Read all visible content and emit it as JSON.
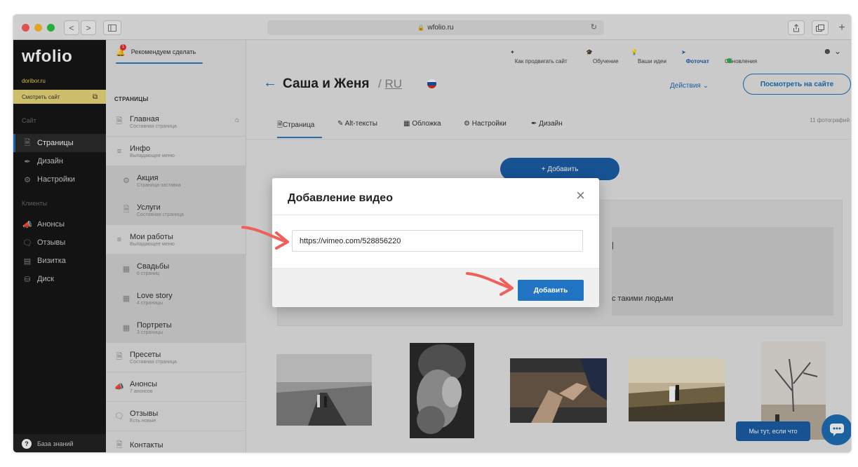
{
  "browser": {
    "url": "wfolio.ru",
    "lock_icon": "lock-icon",
    "buttons": [
      "<",
      ">"
    ]
  },
  "sidebar": {
    "logo": "wfolio",
    "domain": "doribor.ru",
    "view_site_label": "Смотреть сайт",
    "section_site": "Сайт",
    "section_clients": "Клиенты",
    "items": [
      {
        "label": "Страницы",
        "icon": "page-icon",
        "active": true
      },
      {
        "label": "Дизайн",
        "icon": "brush-icon",
        "active": false
      },
      {
        "label": "Настройки",
        "icon": "gear-icon",
        "active": false
      },
      {
        "label": "Анонсы",
        "icon": "megaphone-icon",
        "active": false
      },
      {
        "label": "Отзывы",
        "icon": "chat-icon",
        "active": false
      },
      {
        "label": "Визитка",
        "icon": "card-icon",
        "active": false
      },
      {
        "label": "Диск",
        "icon": "disk-icon",
        "active": false
      }
    ],
    "knowledge_base": "База знаний"
  },
  "pages_panel": {
    "recommend": "Рекомендуем сделать",
    "recommend_badge": "1",
    "title": "СТРАНИЦЫ",
    "items": [
      {
        "title": "Главная",
        "subtitle": "Составная страница",
        "icon": "page-icon",
        "sub": false
      },
      {
        "title": "Инфо",
        "subtitle": "Выпадающее меню",
        "icon": "menu-icon",
        "sub": false
      },
      {
        "title": "Акция",
        "subtitle": "Страница-заставка",
        "icon": "gear-icon",
        "sub": true
      },
      {
        "title": "Услуги",
        "subtitle": "Составная страница",
        "icon": "page-icon",
        "sub": true
      },
      {
        "title": "Мои работы",
        "subtitle": "Выпадающее меню",
        "icon": "menu-icon",
        "sub": false
      },
      {
        "title": "Свадьбы",
        "subtitle": "6 страниц",
        "icon": "grid-icon",
        "sub": true
      },
      {
        "title": "Love story",
        "subtitle": "4 страницы",
        "icon": "grid-icon",
        "sub": true
      },
      {
        "title": "Портреты",
        "subtitle": "3 страницы",
        "icon": "grid-icon",
        "sub": true
      },
      {
        "title": "Пресеты",
        "subtitle": "Составная страница",
        "icon": "page-icon",
        "sub": false
      },
      {
        "title": "Анонсы",
        "subtitle": "7 анонсов",
        "icon": "megaphone-icon",
        "sub": false
      },
      {
        "title": "Отзывы",
        "subtitle": "Есть новые",
        "icon": "chat-icon",
        "sub": false
      },
      {
        "title": "Контакты",
        "subtitle": "",
        "icon": "page-icon",
        "sub": false
      }
    ]
  },
  "topnav": {
    "promote": "Как продвигать сайт",
    "learning": "Обучение",
    "ideas": "Ваши идеи",
    "fotochat": "Фоточат",
    "updates": "Обновления"
  },
  "header": {
    "back": "←",
    "title": "Саша и Женя",
    "lang_prefix": "/",
    "lang": "RU",
    "actions": "Действия ⌄",
    "view_button": "Посмотреть на сайте",
    "photo_count": "11 фотографий"
  },
  "tabs": [
    {
      "label": "Страница",
      "icon": "page-icon"
    },
    {
      "label": "Alt-тексты",
      "icon": "edit-icon"
    },
    {
      "label": "Обложка",
      "icon": "image-icon"
    },
    {
      "label": "Настройки",
      "icon": "gear-icon"
    },
    {
      "label": "Дизайн",
      "icon": "brush-icon"
    }
  ],
  "main": {
    "add_button": "+ Добавить",
    "card_text": "с такими людьми",
    "card_mark": "|"
  },
  "modal": {
    "title": "Добавление видео",
    "close": "×",
    "input_value": "https://vimeo.com/528856220",
    "add_button": "Добавить"
  },
  "chat": {
    "bubble": "Мы тут, если что"
  },
  "colors": {
    "accent": "#1e6fb7",
    "sidebar_bg": "#161616",
    "highlight": "#e9d97a",
    "arrow": "#f0605a"
  }
}
